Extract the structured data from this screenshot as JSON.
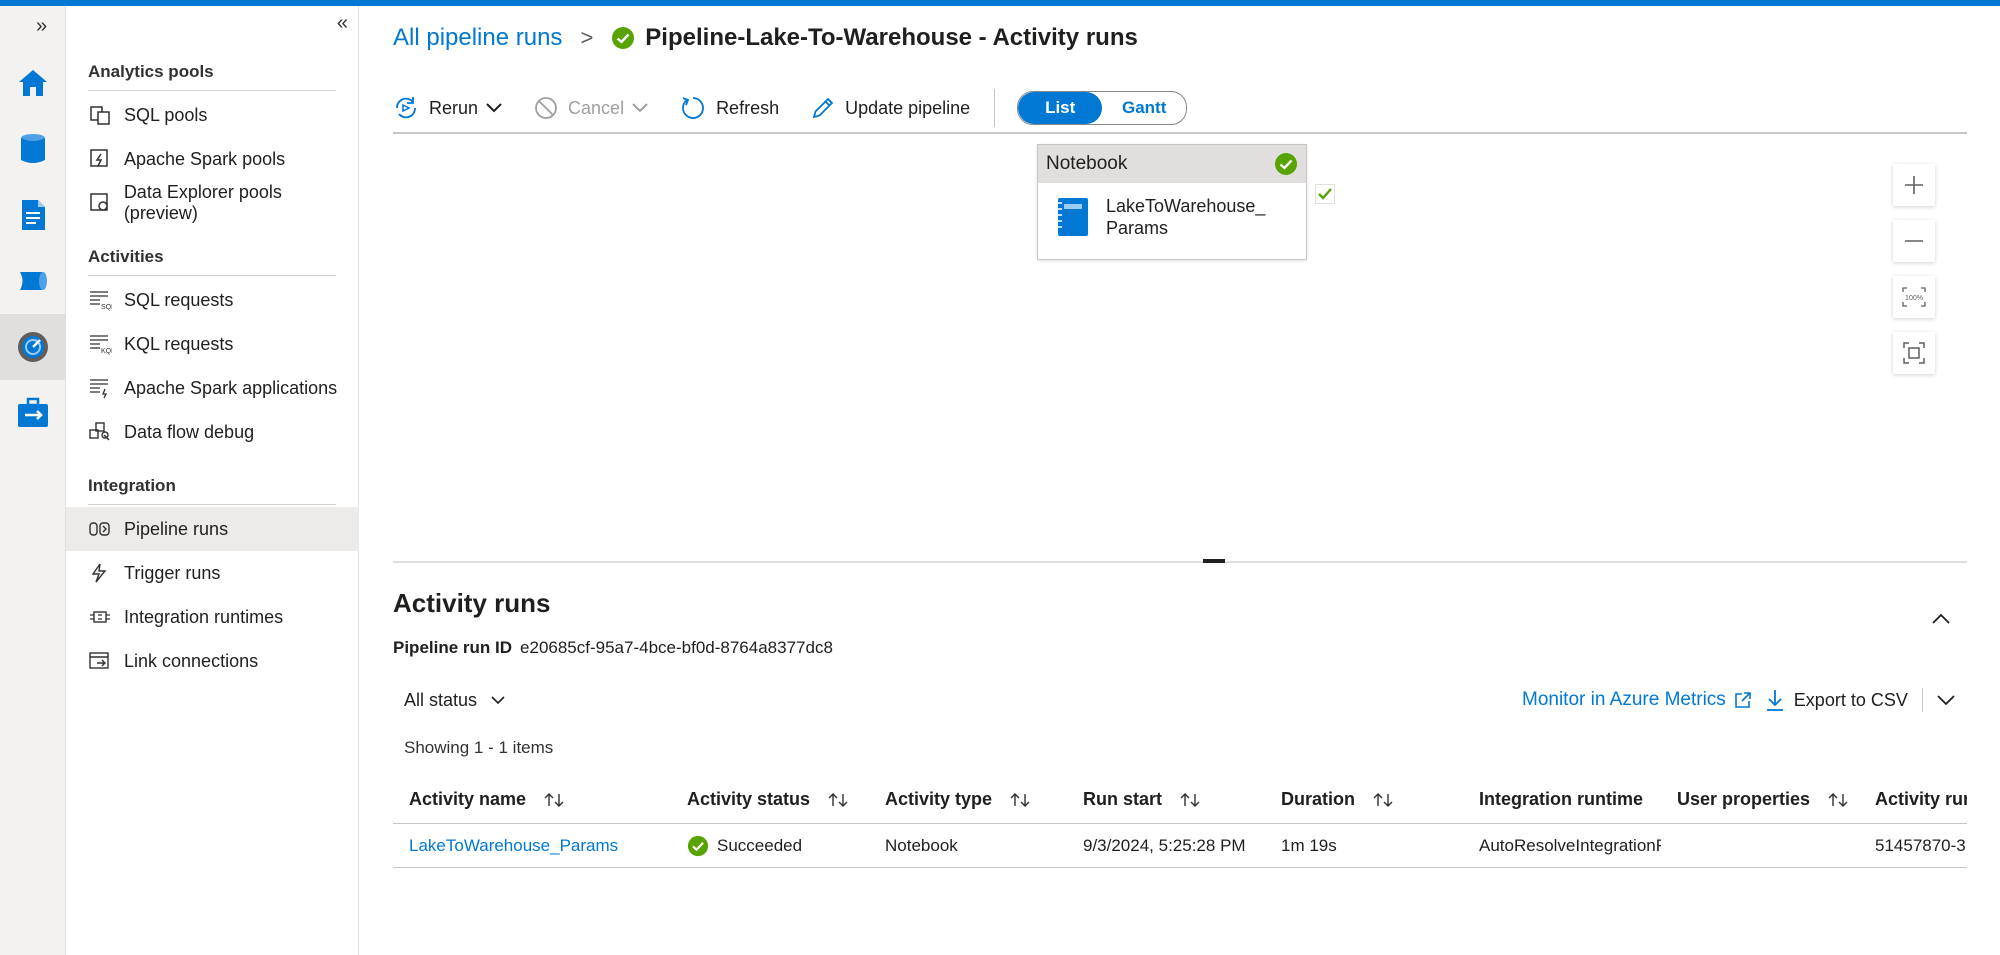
{
  "colors": {
    "accent": "#0078d4",
    "success": "#57a300"
  },
  "rail": {
    "expand_label": "»",
    "items": [
      {
        "icon": "home-icon"
      },
      {
        "icon": "data-icon"
      },
      {
        "icon": "develop-icon"
      },
      {
        "icon": "integrate-icon"
      },
      {
        "icon": "monitor-icon"
      },
      {
        "icon": "manage-icon"
      }
    ]
  },
  "nav": {
    "collapse_label": "«",
    "sections": [
      {
        "title": "Analytics pools"
      },
      {
        "title": "Activities"
      },
      {
        "title": "Integration"
      }
    ],
    "items": [
      {
        "label": "SQL pools",
        "icon": "sql-pools-icon"
      },
      {
        "label": "Apache Spark pools",
        "icon": "spark-pools-icon"
      },
      {
        "label": "Data Explorer pools (preview)",
        "icon": "data-explorer-pools-icon"
      },
      {
        "label": "SQL requests",
        "icon": "sql-requests-icon"
      },
      {
        "label": "KQL requests",
        "icon": "kql-requests-icon"
      },
      {
        "label": "Apache Spark applications",
        "icon": "spark-applications-icon"
      },
      {
        "label": "Data flow debug",
        "icon": "data-flow-debug-icon"
      },
      {
        "label": "Pipeline runs",
        "icon": "pipeline-runs-icon"
      },
      {
        "label": "Trigger runs",
        "icon": "trigger-runs-icon"
      },
      {
        "label": "Integration runtimes",
        "icon": "integration-runtimes-icon"
      },
      {
        "label": "Link connections",
        "icon": "link-connections-icon"
      }
    ]
  },
  "breadcrumb": {
    "parent": "All pipeline runs",
    "separator": ">",
    "title": "Pipeline-Lake-To-Warehouse - Activity runs"
  },
  "toolbar": {
    "rerun": "Rerun",
    "cancel": "Cancel",
    "refresh": "Refresh",
    "update": "Update pipeline",
    "view_list": "List",
    "view_gantt": "Gantt"
  },
  "canvas": {
    "activity_type": "Notebook",
    "activity_name_line1": "LakeToWarehouse_",
    "activity_name_line2": "Params"
  },
  "runs": {
    "title": "Activity runs",
    "pipeline_run_id_label": "Pipeline run ID",
    "pipeline_run_id": "e20685cf-95a7-4bce-bf0d-8764a8377dc8",
    "filter": "All status",
    "showing": "Showing 1 - 1 items",
    "monitor_link": "Monitor in Azure Metrics",
    "export": "Export to CSV",
    "columns": [
      "Activity name",
      "Activity status",
      "Activity type",
      "Run start",
      "Duration",
      "Integration runtime",
      "User properties",
      "Activity run"
    ],
    "rows": [
      {
        "name": "LakeToWarehouse_Params",
        "status": "Succeeded",
        "type": "Notebook",
        "run_start": "9/3/2024, 5:25:28 PM",
        "duration": "1m 19s",
        "runtime": "AutoResolveIntegrationRuntime",
        "user_properties": "",
        "run_id": "51457870-3"
      }
    ]
  }
}
